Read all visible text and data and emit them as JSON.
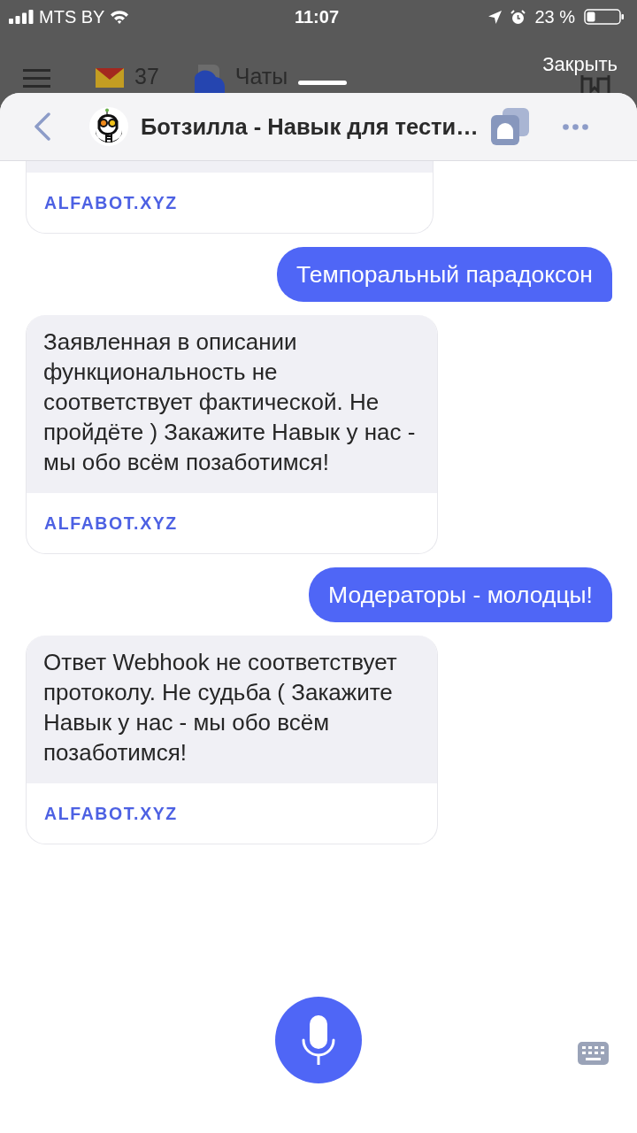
{
  "status_bar": {
    "carrier": "MTS BY",
    "time": "11:07",
    "battery": "23 %"
  },
  "background_app": {
    "mail_count": "37",
    "chats_label": "Чаты",
    "close_label": "Закрыть"
  },
  "header": {
    "title": "Ботзилла - Навык для тести…"
  },
  "messages": [
    {
      "kind": "bot",
      "link": "ALFABOT.XYZ"
    },
    {
      "kind": "user",
      "text": "Темпоральный парадоксон"
    },
    {
      "kind": "bot",
      "text": "Заявленная в описании функциональность не соответствует фактической. Не пройдёте ) Закажите Навык у нас - мы обо всём позаботимся!",
      "link": "ALFABOT.XYZ"
    },
    {
      "kind": "user",
      "text": "Модераторы - молодцы!"
    },
    {
      "kind": "bot",
      "text": "Ответ Webhook не соответствует протоколу. Не судьба ( Закажите Навык у нас - мы обо всём позаботимся!",
      "link": "ALFABOT.XYZ"
    }
  ]
}
